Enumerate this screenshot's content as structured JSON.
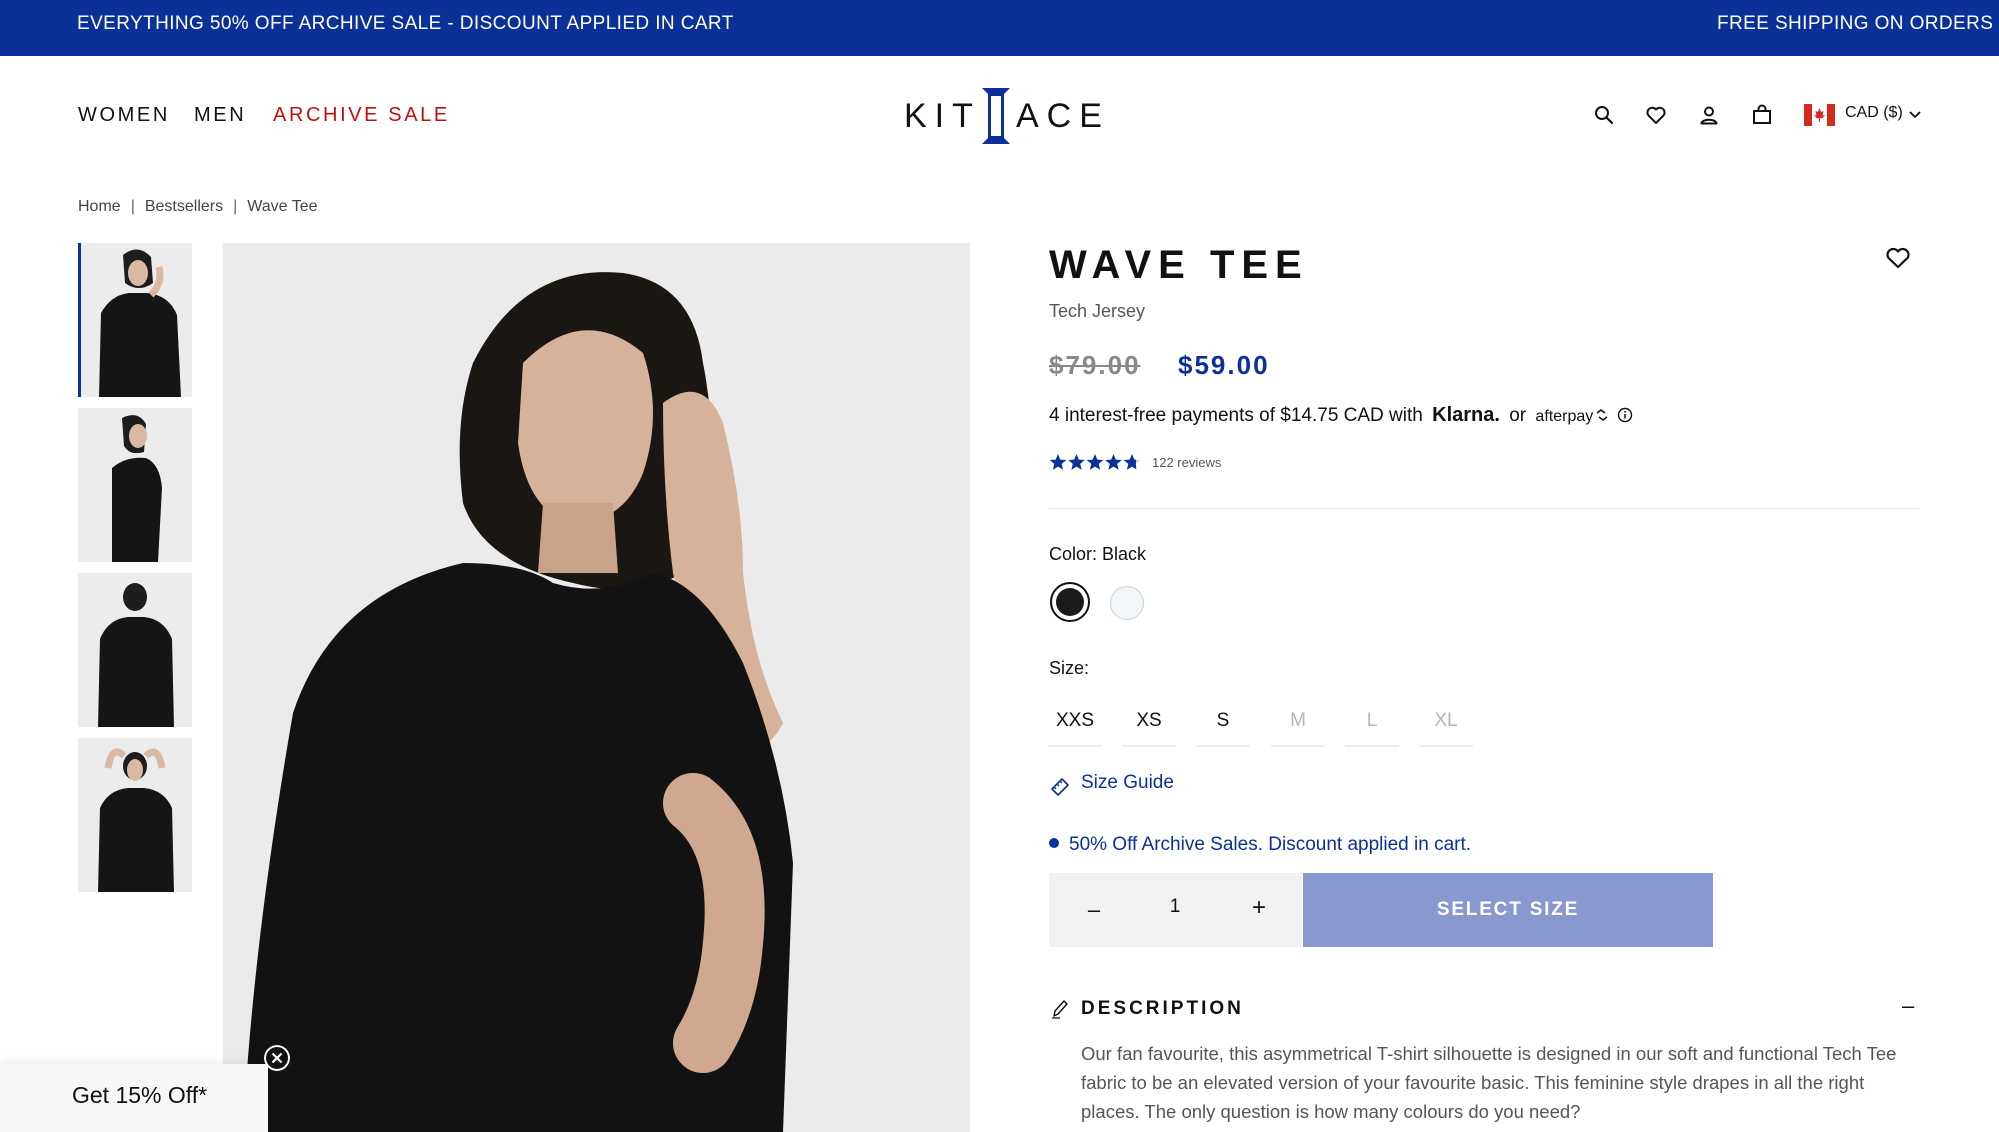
{
  "announcement": {
    "left_text": "EVERYTHING 50% OFF ARCHIVE SALE - DISCOUNT APPLIED IN CART",
    "right_text": "FREE SHIPPING ON ORDERS C"
  },
  "header": {
    "nav": [
      "WOMEN",
      "MEN",
      "ARCHIVE SALE"
    ],
    "logo_left": "KIT",
    "logo_right": "ACE",
    "currency": "CAD ($)",
    "icons": [
      "search-icon",
      "heart-icon",
      "account-icon",
      "bag-icon",
      "canada-flag-icon",
      "chevron-down-icon"
    ]
  },
  "breadcrumb": [
    "Home",
    "Bestsellers",
    "Wave Tee"
  ],
  "product": {
    "title": "WAVE TEE",
    "subtitle": "Tech Jersey",
    "old_price": "$79.00",
    "new_price": "$59.00",
    "installment_text": "4 interest-free payments of $14.75 CAD with",
    "klarna": "Klarna.",
    "or": "or",
    "afterpay": "afterpay",
    "rating": 4.8,
    "reviews": "122 reviews",
    "color_label": "Color: Black",
    "colors": [
      "#1a1a1a",
      "#f2f6f8"
    ],
    "size_label": "Size:",
    "sizes": [
      {
        "label": "XXS",
        "available": true
      },
      {
        "label": "XS",
        "available": true
      },
      {
        "label": "S",
        "available": true
      },
      {
        "label": "M",
        "available": false
      },
      {
        "label": "L",
        "available": false
      },
      {
        "label": "XL",
        "available": false
      }
    ],
    "size_guide": "Size Guide",
    "promo": "50% Off Archive Sales. Discount applied in cart.",
    "quantity": "1",
    "minus": "–",
    "plus": "+",
    "cta": "SELECT SIZE",
    "description_title": "DESCRIPTION",
    "description_toggle": "–",
    "description": "Our fan favourite, this asymmetrical T-shirt silhouette is designed in our soft and functional Tech Tee fabric to be an elevated version of your favourite basic. This feminine style drapes in all the right places. The only question is how many colours do you need?"
  },
  "popup": {
    "text": "Get 15% Off*"
  },
  "colors": {
    "brand_blue": "#0b3199",
    "sale_red": "#c01010",
    "cta_disabled": "#8899cf"
  }
}
